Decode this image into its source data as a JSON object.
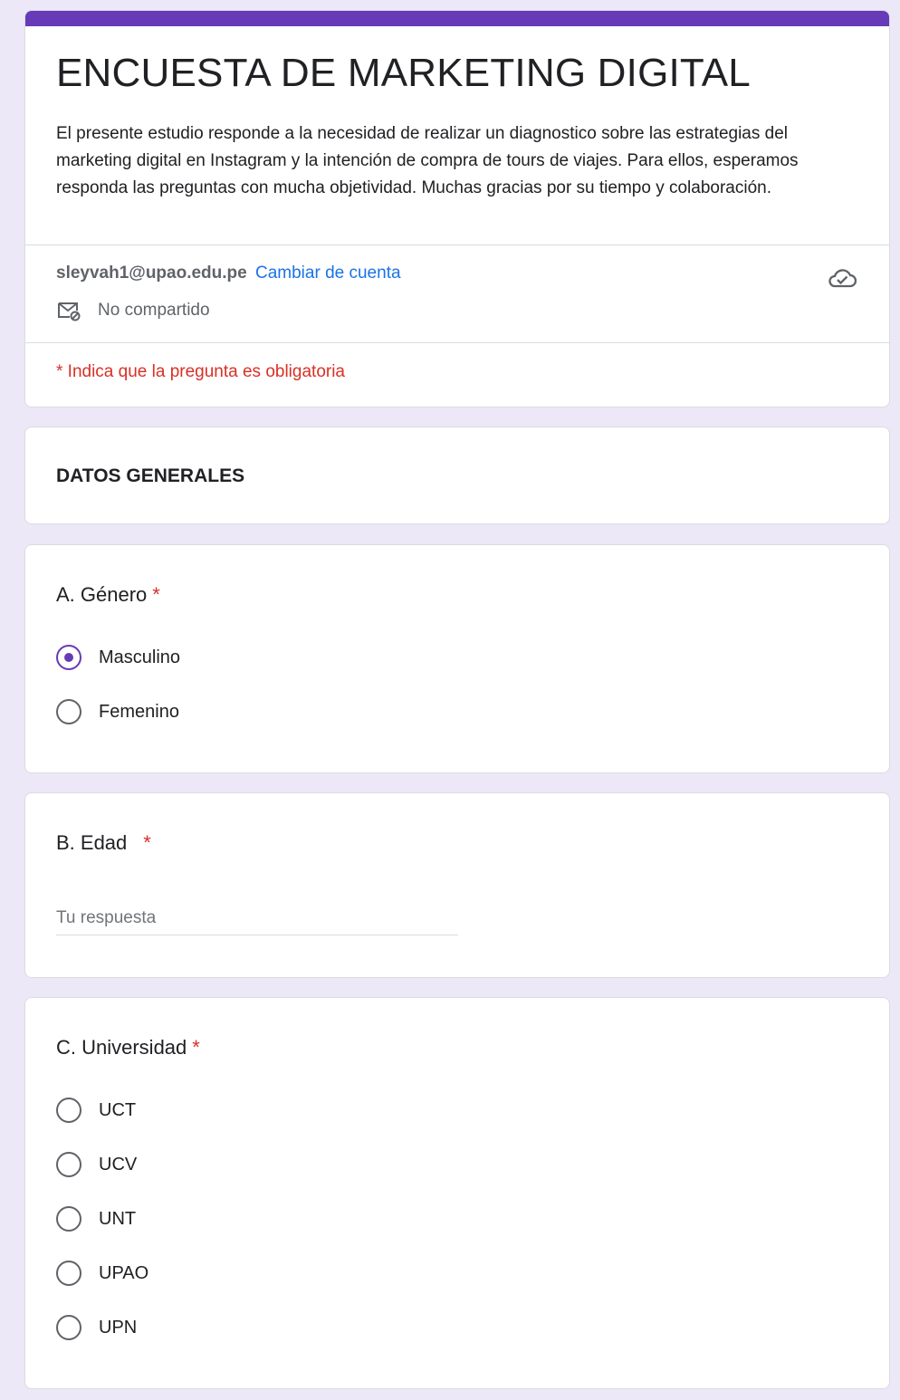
{
  "form": {
    "title": "ENCUESTA DE MARKETING DIGITAL",
    "description": "El presente estudio responde a la necesidad de realizar un diagnostico sobre las estrategias del marketing digital en Instagram y la intención de compra de tours de viajes. Para ellos, esperamos responda las preguntas con mucha objetividad. Muchas gracias por su tiempo y colaboración.",
    "account_email": "sleyvah1@upao.edu.pe",
    "switch_account_label": "Cambiar de cuenta",
    "not_shared_label": "No compartido",
    "required_note": "* Indica que la pregunta es obligatoria",
    "accent_color": "#673ab7"
  },
  "section": {
    "title": "DATOS GENERALES"
  },
  "questions": [
    {
      "title": "A. Género",
      "required_mark": "*",
      "options": [
        "Masculino",
        "Femenino"
      ],
      "selected": "Masculino"
    },
    {
      "title": "B. Edad",
      "required_mark": "*",
      "placeholder": "Tu respuesta",
      "value": ""
    },
    {
      "title": "C. Universidad",
      "required_mark": "*",
      "options": [
        "UCT",
        "UCV",
        "UNT",
        "UPAO",
        "UPN"
      ],
      "selected": null
    }
  ],
  "icons": {
    "cloud": "cloud-check-icon",
    "mail": "mail-not-shared-icon"
  }
}
